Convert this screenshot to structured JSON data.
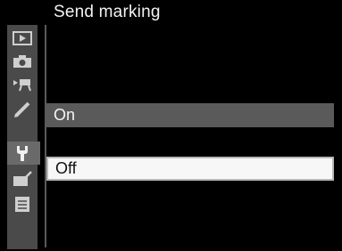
{
  "header": {
    "title": "Send marking"
  },
  "tabs": [
    {
      "icon": "playback-icon"
    },
    {
      "icon": "camera-icon"
    },
    {
      "icon": "movie-icon"
    },
    {
      "icon": "pencil-icon"
    },
    {
      "icon": "wrench-icon",
      "active": true
    },
    {
      "icon": "retouch-icon"
    },
    {
      "icon": "recent-settings-icon"
    }
  ],
  "menu": {
    "options": [
      {
        "label": "On",
        "selected": false
      },
      {
        "label": "Off",
        "selected": true
      }
    ]
  },
  "colors": {
    "background": "#000000",
    "highlight": "#f7f7f7",
    "option_bar": "#5a5a5a",
    "tab_strip": "#4a4a4a"
  }
}
